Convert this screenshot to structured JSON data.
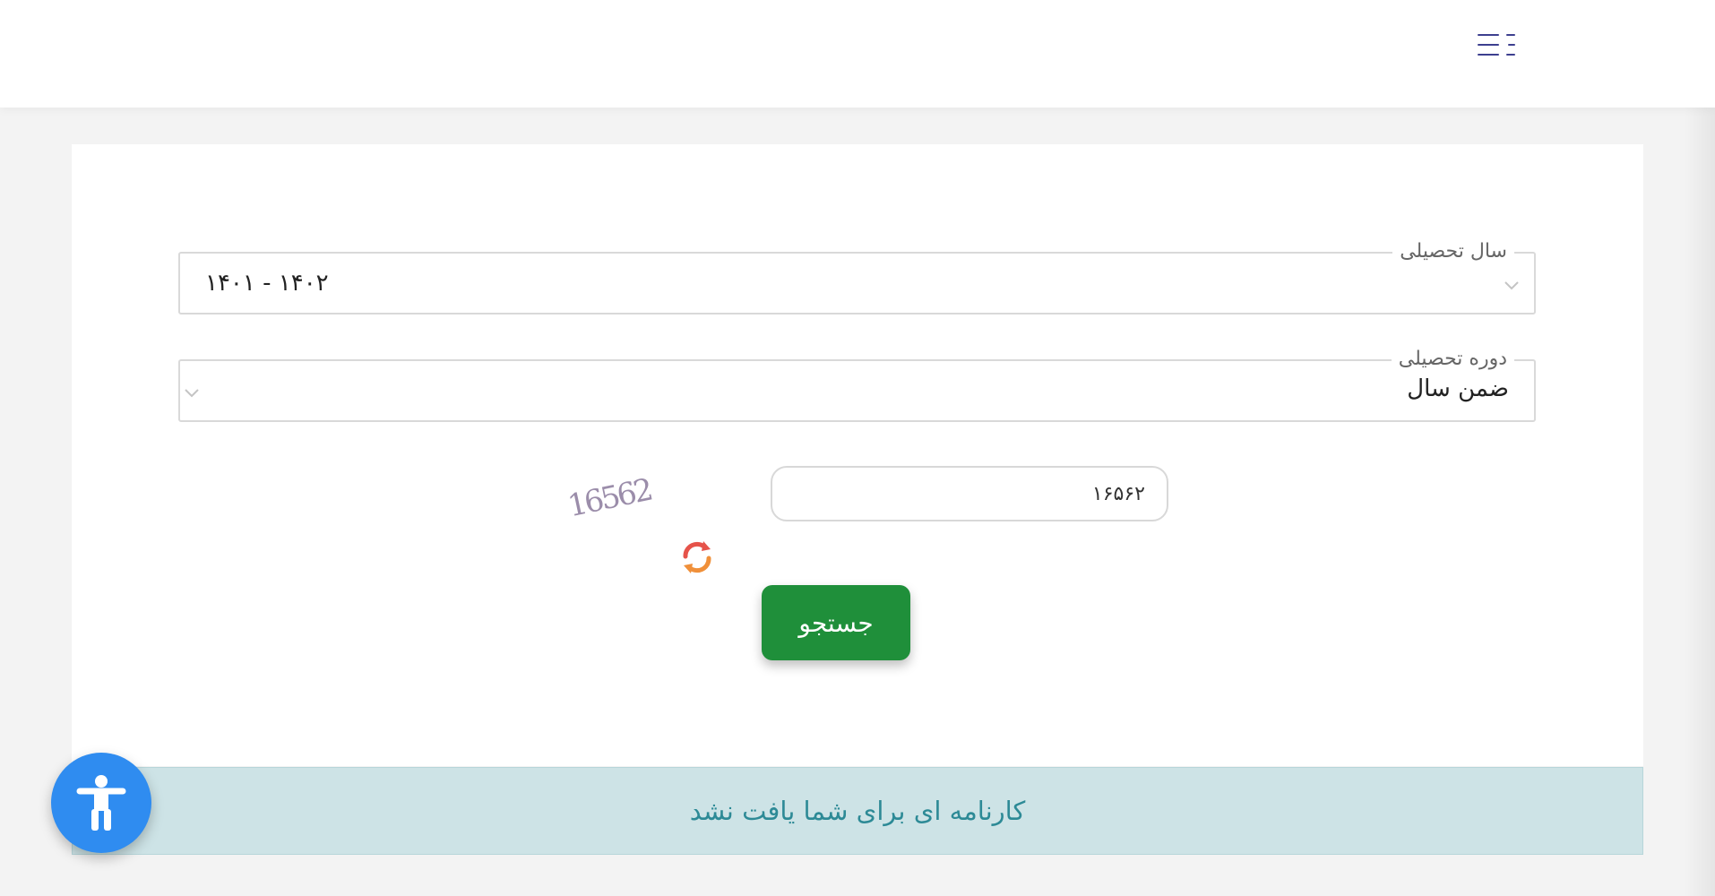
{
  "header": {
    "menu_icon": "hamburger-menu-icon"
  },
  "form": {
    "academic_year": {
      "label": "سال تحصیلی",
      "value": "۱۴۰۱ - ۱۴۰۲"
    },
    "academic_period": {
      "label": "دوره تحصیلی",
      "value": "ضمن سال"
    },
    "captcha": {
      "input_value": "۱۶۵۶۲",
      "image_text": "16562",
      "refresh_icon": "refresh-icon"
    },
    "search_label": "جستجو"
  },
  "alert": {
    "message": "کارنامه ای برای شما یافت نشد"
  },
  "accessibility": {
    "icon": "accessibility-icon"
  },
  "colors": {
    "primary_button": "#1f8f3a",
    "alert_bg": "#cde3e6",
    "alert_text": "#2d8a96",
    "accessibility_bg": "#2f8cf0",
    "menu_icon": "#3d3f8f"
  }
}
